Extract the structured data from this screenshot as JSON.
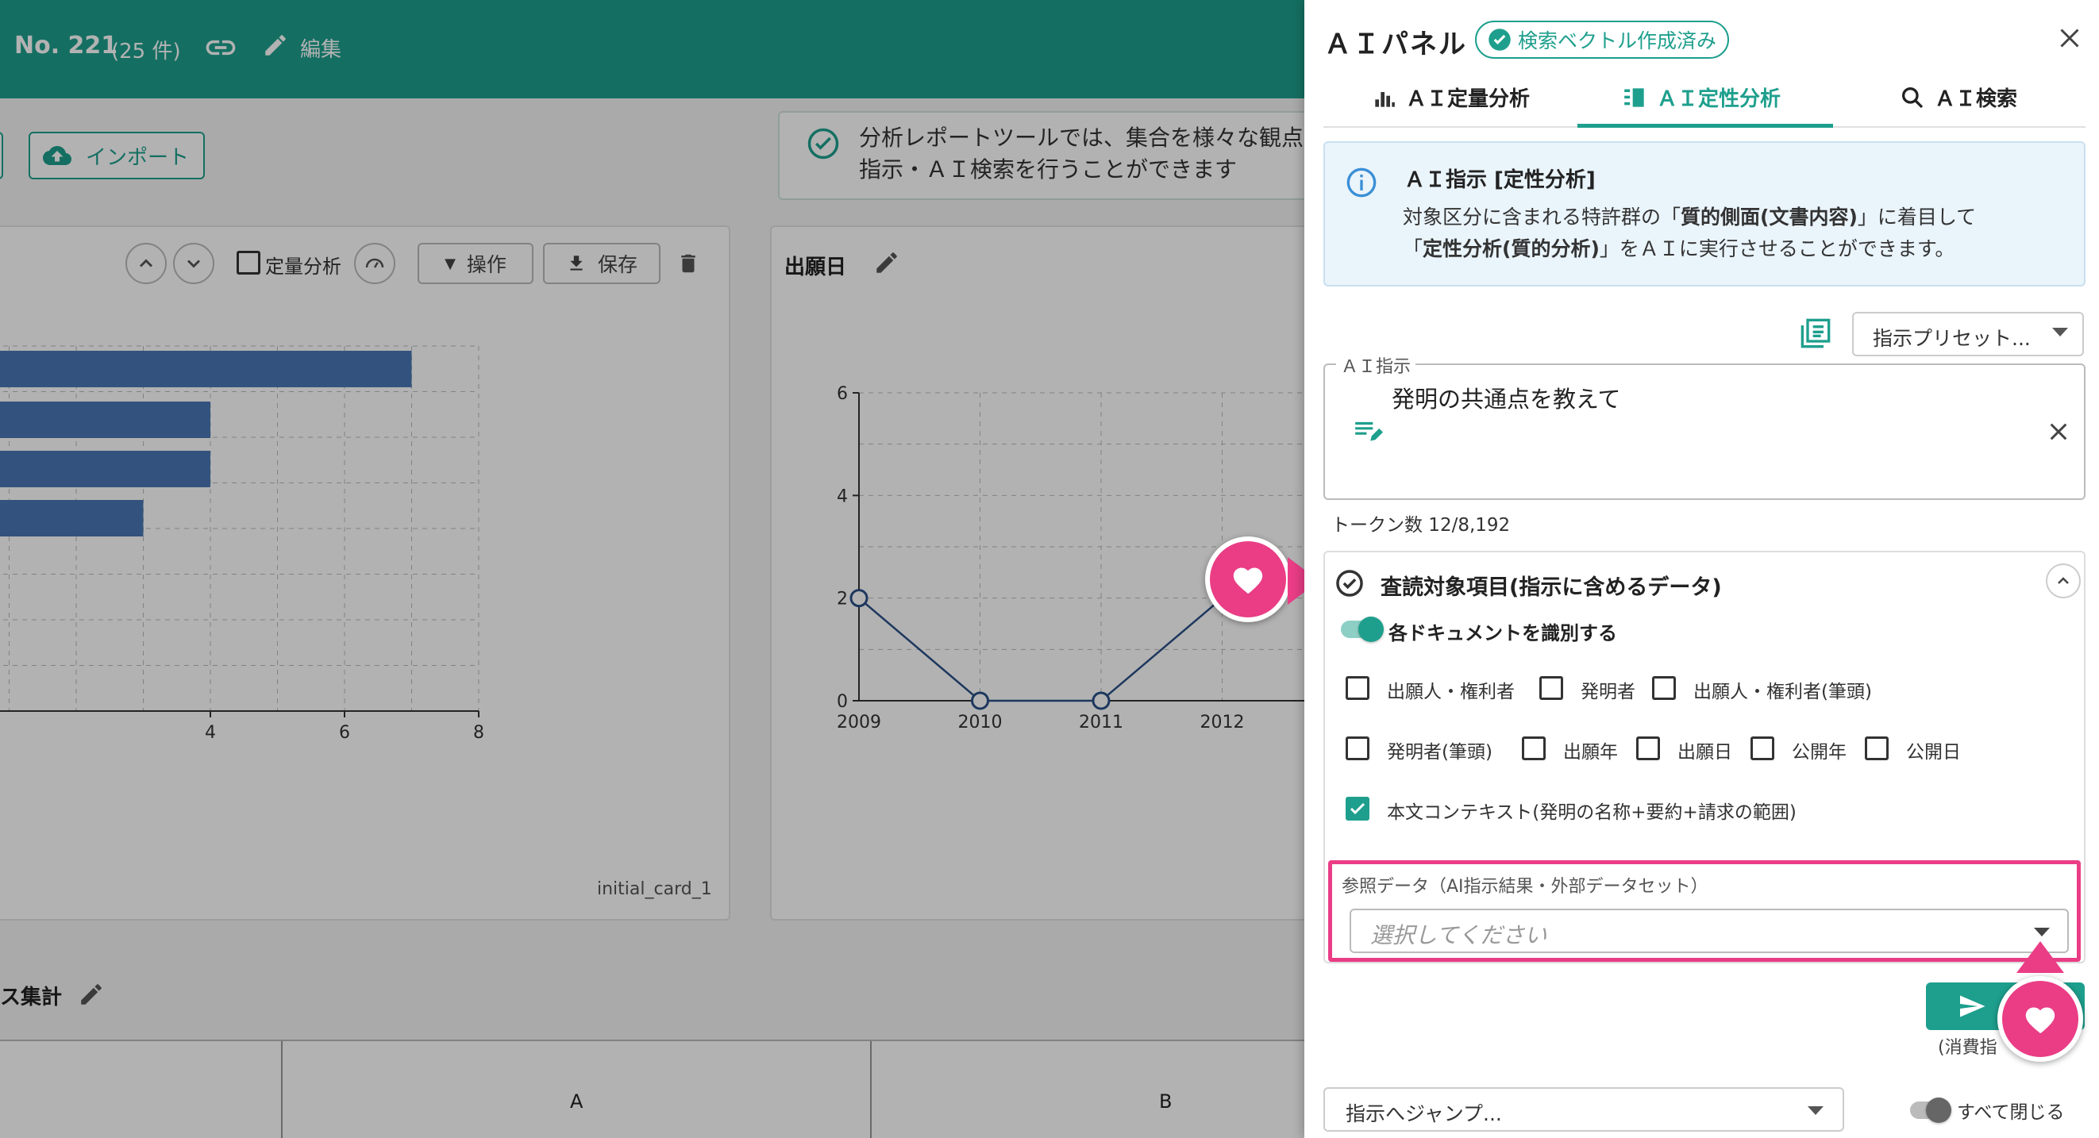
{
  "app": {
    "record_no": "No. 221",
    "record_count": "(25 件)",
    "edit_label": "編集",
    "import_label": "インポート",
    "notice_line1": "分析レポートツールでは、集合を様々な観点",
    "notice_line2": "指示・ＡＩ検索を行うことができます"
  },
  "card1": {
    "toolbar": {
      "quant_label": "定量分析",
      "operate_label": "操作",
      "save_label": "保存"
    },
    "footer": "initial_card_1"
  },
  "card2": {
    "title": "出願日"
  },
  "section": {
    "title": "ス集計"
  },
  "table": {
    "col_a": "A",
    "col_b": "B"
  },
  "panel": {
    "title": "ＡＩパネル",
    "badge": "検索ベクトル作成済み",
    "tabs": [
      {
        "label": "ＡＩ定量分析",
        "icon": "bar-chart-icon"
      },
      {
        "label": "ＡＩ定性分析",
        "icon": "list-chart-icon"
      },
      {
        "label": "ＡＩ検索",
        "icon": "search-icon"
      }
    ],
    "info": {
      "title": "ＡＩ指示 [定性分析]",
      "line1_a": "対象区分に含まれる特許群の「",
      "line1_b": "質的側面(文書内容)",
      "line1_c": "」に着目して",
      "line2_a": "「",
      "line2_b": "定性分析(質的分析)",
      "line2_c": "」をＡＩに実行させることができます。"
    },
    "preset_label": "指示プリセット...",
    "instruction": {
      "legend": "ＡＩ指示",
      "value": "発明の共通点を教えて"
    },
    "token_count": "トークン数 12/8,192",
    "review": {
      "title": "査読対象項目(指示に含めるデータ)",
      "toggle_label": "各ドキュメントを識別する",
      "toggle_on": true,
      "checkboxes_row1": [
        {
          "label": "出願人・権利者",
          "checked": false
        },
        {
          "label": "発明者",
          "checked": false
        },
        {
          "label": "出願人・権利者(筆頭)",
          "checked": false
        }
      ],
      "checkboxes_row2": [
        {
          "label": "発明者(筆頭)",
          "checked": false
        },
        {
          "label": "出願年",
          "checked": false
        },
        {
          "label": "出願日",
          "checked": false
        },
        {
          "label": "公開年",
          "checked": false
        },
        {
          "label": "公開日",
          "checked": false
        }
      ],
      "checkbox_context": {
        "label": "本文コンテキスト(発明の名称+要約+請求の範囲)",
        "checked": true
      },
      "ref_legend": "参照データ（AI指示結果・外部データセット）",
      "ref_placeholder": "選択してください"
    },
    "consume_label": "(消費指",
    "jump_label": "指示へジャンプ...",
    "close_all_label": "すべて閉じる",
    "close_all_on": false
  },
  "chart_data": [
    {
      "type": "bar",
      "orientation": "horizontal",
      "categories": [
        "",
        "",
        "",
        ""
      ],
      "values": [
        7,
        4,
        4,
        3
      ],
      "xticks": [
        "4",
        "6",
        "8"
      ],
      "xlim": [
        0,
        8
      ]
    },
    {
      "type": "line",
      "title": "出願日",
      "x": [
        "2009",
        "2010",
        "2011",
        "2012"
      ],
      "values": [
        2,
        0,
        0,
        2
      ],
      "yticks": [
        "0",
        "2",
        "4",
        "6"
      ],
      "ylim": [
        0,
        6
      ]
    }
  ],
  "colors": {
    "teal": "#1e9f8d",
    "pink": "#ea3d86",
    "bar": "#4a78b5"
  }
}
